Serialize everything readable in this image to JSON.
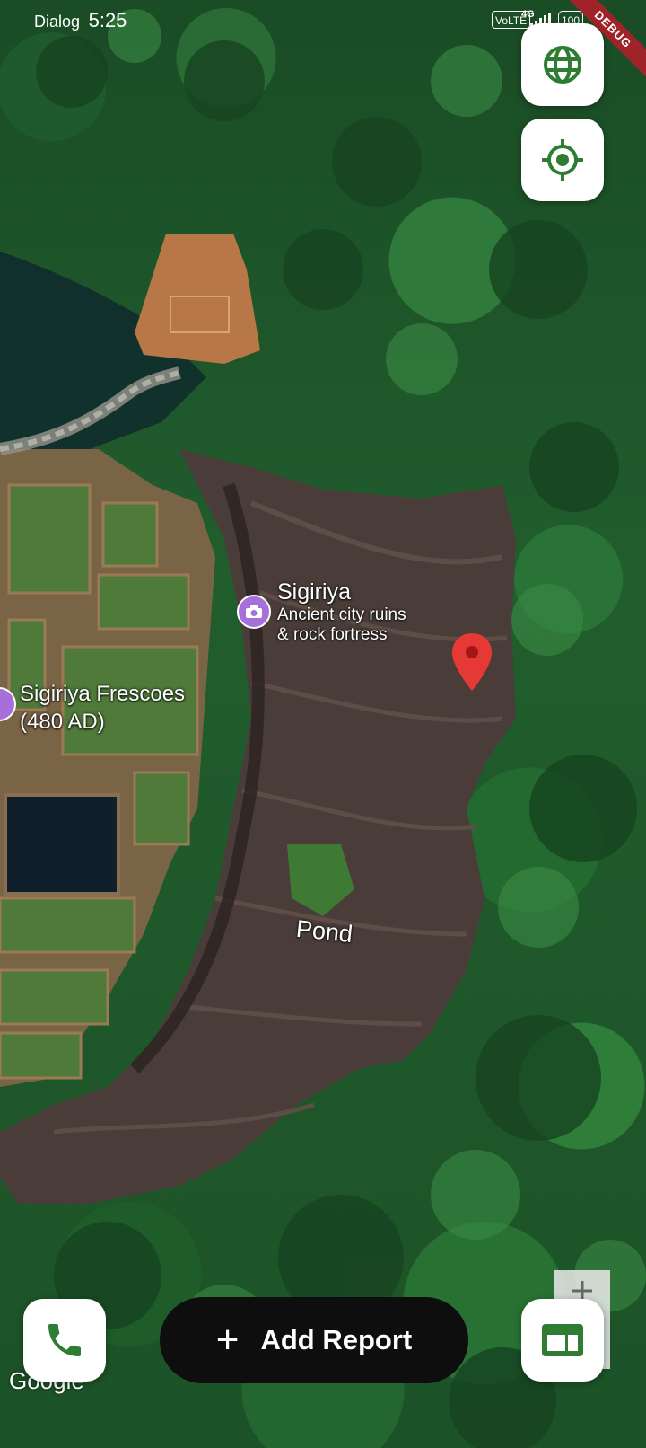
{
  "status_bar": {
    "carrier": "Dialog",
    "time": "5:25",
    "volte": "VoLTE",
    "network": "4G",
    "battery": "100"
  },
  "debug_banner": "DEBUG",
  "map": {
    "labels": [
      {
        "title": "Sigiriya",
        "subtitle_line1": "Ancient city ruins",
        "subtitle_line2": "& rock fortress"
      },
      {
        "title_line1": "Sigiriya Frescoes",
        "title_line2": "(480 AD)"
      }
    ],
    "area_label": "Pond",
    "attribution": "Google",
    "marker_color": "#e53935",
    "poi_color": "#a66fd9"
  },
  "buttons": {
    "layers_icon": "globe-icon",
    "locate_icon": "gps-target-icon",
    "call_icon": "phone-icon",
    "reports_icon": "panel-icon",
    "add_report_label": "Add Report"
  },
  "colors": {
    "accent_green": "#2e7d32",
    "fab_bg": "#ffffff",
    "add_report_bg": "#0e0e0e"
  }
}
